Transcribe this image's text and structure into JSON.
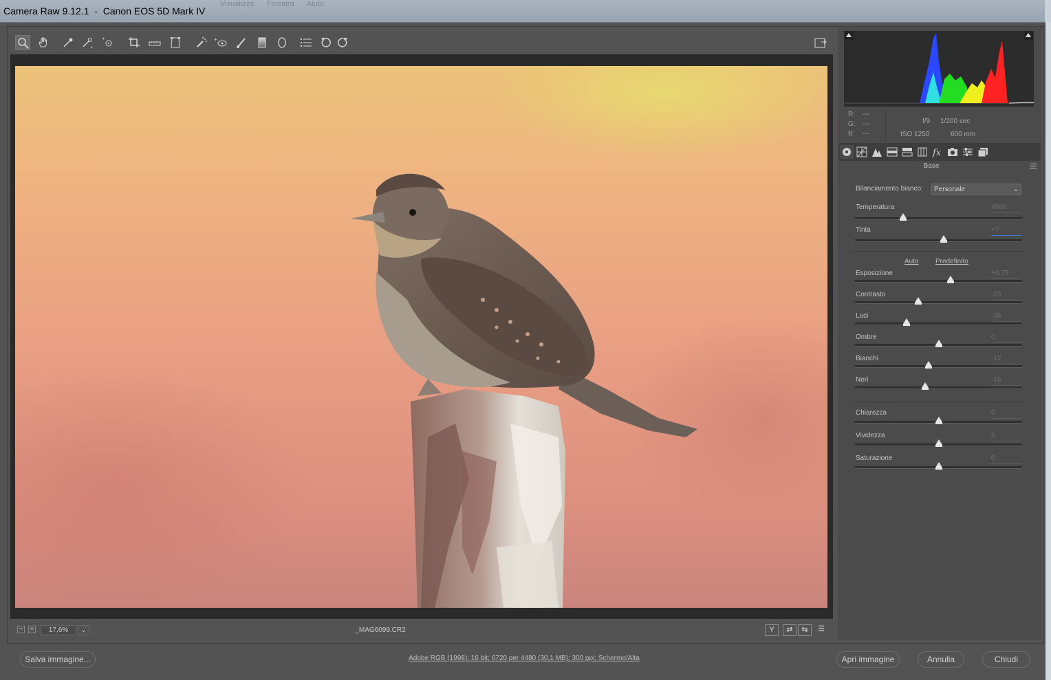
{
  "window": {
    "title": "Camera Raw 9.12.1  -  Canon EOS 5D Mark IV",
    "background_menu": [
      "Visualizza",
      "Finestra",
      "Aiuto"
    ]
  },
  "toolbar": {
    "tools": [
      "zoom-icon",
      "hand-icon",
      "white-balance-eyedropper-icon",
      "color-sampler-icon",
      "target-adjustment-icon",
      "crop-icon",
      "straighten-icon",
      "transform-icon",
      "spot-removal-icon",
      "red-eye-icon",
      "adjustment-brush-icon",
      "graduated-filter-icon",
      "radial-filter-icon",
      "preferences-icon",
      "rotate-left-icon",
      "rotate-right-icon"
    ],
    "fullscreen_icon": "fullscreen-icon"
  },
  "preview": {
    "zoom_minus": "−",
    "zoom_plus": "+",
    "zoom_value": "17,6%",
    "filename": "_MAG6099.CR2",
    "view_buttons": [
      "Y",
      "⇄",
      "⇆",
      "☰"
    ]
  },
  "histogram": {
    "colors": {
      "red": "#ff2020",
      "green": "#20e020",
      "blue": "#2040ff",
      "yellow": "#f0f000",
      "cyan": "#20e0e0",
      "white": "#ffffff"
    }
  },
  "info": {
    "r": "R:    ---",
    "g": "G:    ---",
    "b": "B:    ---",
    "aperture": "f/9",
    "shutter": "1/200 sec",
    "iso": "ISO 1250",
    "focal": "600 mm"
  },
  "panel": {
    "tabs": [
      "basic-icon",
      "tone-curve-icon",
      "detail-icon",
      "hsl-icon",
      "split-toning-icon",
      "lens-corrections-icon",
      "effects-icon",
      "camera-calibration-icon",
      "presets-icon",
      "snapshots-icon"
    ],
    "section_title": "Base",
    "wb_label": "Bilanciamento bianco:",
    "wb_value": "Personale",
    "auto": "Auto",
    "default": "Predefinito",
    "sliders": [
      {
        "label": "Temperatura",
        "value": "4900",
        "level": 0.29
      },
      {
        "label": "Tinta",
        "value": "+7",
        "level": 0.53
      },
      {
        "label": "Esposizione",
        "value": "+0,75",
        "level": 0.57
      },
      {
        "label": "Contrasto",
        "value": "-23",
        "level": 0.38
      },
      {
        "label": "Luci",
        "value": "-38",
        "level": 0.31
      },
      {
        "label": "Ombre",
        "value": "0",
        "level": 0.5
      },
      {
        "label": "Bianchi",
        "value": "-12",
        "level": 0.44
      },
      {
        "label": "Neri",
        "value": "-16",
        "level": 0.42
      },
      {
        "label": "Chiarezza",
        "value": "0",
        "level": 0.5
      },
      {
        "label": "Vividezza",
        "value": "0",
        "level": 0.5
      },
      {
        "label": "Saturazione",
        "value": "0",
        "level": 0.5
      }
    ]
  },
  "bottom": {
    "save": "Salva immagine...",
    "workflow": "Adobe RGB (1998); 16 bit; 6720 per 4480 (30,1 MB); 300 ppi; Schermo/Alta",
    "open": "Apri immagine",
    "cancel": "Annulla",
    "done": "Chiudi"
  }
}
